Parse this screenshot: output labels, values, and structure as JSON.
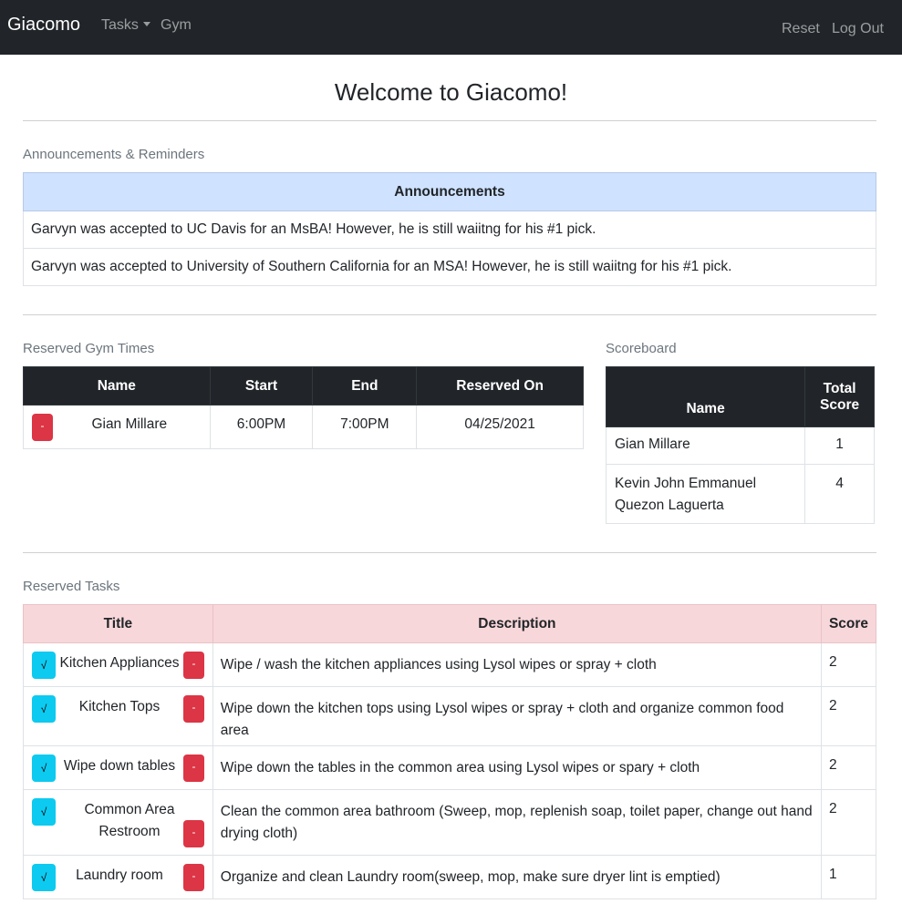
{
  "navbar": {
    "brand": "Giacomo",
    "tasks_label": "Tasks",
    "gym_label": "Gym",
    "reset_label": "Reset",
    "logout_label": "Log Out"
  },
  "page_title": "Welcome to Giacomo!",
  "announcements": {
    "section_label": "Announcements & Reminders",
    "header": "Announcements",
    "items": [
      "Garvyn was accepted to UC Davis for an MsBA! However, he is still waiitng for his #1 pick.",
      "Garvyn was accepted to University of Southern California for an MSA! However, he is still waiitng for his #1 pick."
    ]
  },
  "gym": {
    "section_label": "Reserved Gym Times",
    "columns": [
      "Name",
      "Start",
      "End",
      "Reserved On"
    ],
    "rows": [
      {
        "delete_label": "-",
        "name": "Gian Millare",
        "start": "6:00PM",
        "end": "7:00PM",
        "reserved_on": "04/25/2021"
      }
    ]
  },
  "scoreboard": {
    "section_label": "Scoreboard",
    "columns": [
      "Name",
      "Total Score"
    ],
    "rows": [
      {
        "name": "Gian Millare",
        "score": "1"
      },
      {
        "name": "Kevin John Emmanuel Quezon Laguerta",
        "score": "4"
      }
    ]
  },
  "tasks": {
    "section_label": "Reserved Tasks",
    "columns": [
      "Title",
      "Description",
      "Score"
    ],
    "complete_label": "√",
    "delete_label": "-",
    "rows": [
      {
        "title": "Kitchen Appliances",
        "description": "Wipe / wash the kitchen appliances using Lysol wipes or spray + cloth",
        "score": "2"
      },
      {
        "title": "Kitchen Tops",
        "description": "Wipe down the kitchen tops using Lysol wipes or spray + cloth and organize common food area",
        "score": "2"
      },
      {
        "title": "Wipe down tables",
        "description": "Wipe down the tables in the common area using Lysol wipes or spary + cloth",
        "score": "2"
      },
      {
        "title": "Common Area Restroom",
        "description": "Clean the common area bathroom (Sweep, mop, replenish soap, toilet paper, change out hand drying cloth)",
        "score": "2"
      },
      {
        "title": "Laundry room",
        "description": "Organize and clean Laundry room(sweep, mop, make sure dryer lint is emptied)",
        "score": "1"
      }
    ]
  },
  "colors": {
    "navbar_bg": "#212529",
    "announcement_header_bg": "#cfe2ff",
    "task_header_bg": "#f8d7da",
    "complete_button": "#0dcaf0",
    "delete_button": "#dc3545"
  }
}
